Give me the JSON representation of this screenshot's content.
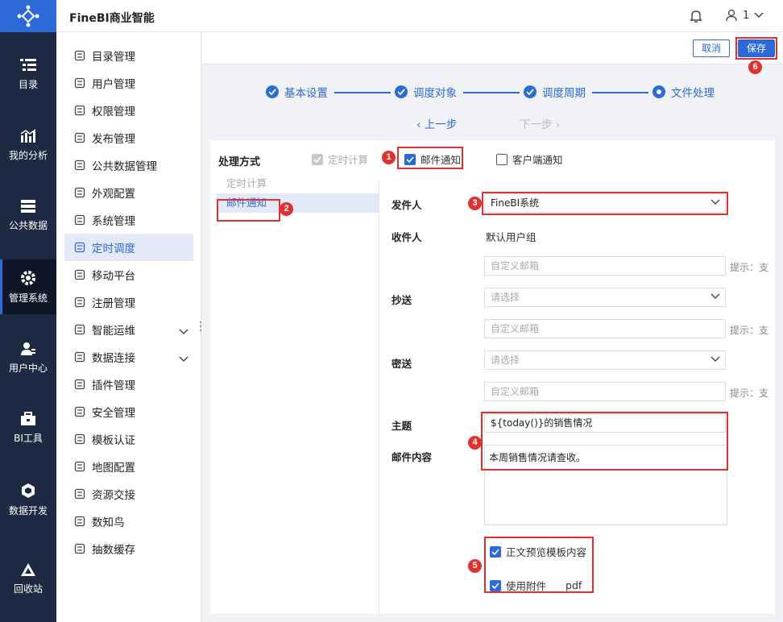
{
  "app": {
    "title": "FineBI商业智能",
    "user": "1"
  },
  "rail": [
    {
      "label": "目录",
      "icon": "catalog-icon"
    },
    {
      "label": "我的分析",
      "icon": "analysis-icon"
    },
    {
      "label": "公共数据",
      "icon": "public-data-icon"
    },
    {
      "label": "管理系统",
      "icon": "gear-icon",
      "active": true
    },
    {
      "label": "用户中心",
      "icon": "user-center-icon"
    },
    {
      "label": "BI工具",
      "icon": "toolbox-icon"
    },
    {
      "label": "数据开发",
      "icon": "data-dev-icon"
    },
    {
      "label": "回收站",
      "icon": "recycle-icon"
    }
  ],
  "subnav": [
    {
      "label": "目录管理",
      "icon": "directory-icon"
    },
    {
      "label": "用户管理",
      "icon": "user-icon"
    },
    {
      "label": "权限管理",
      "icon": "permission-icon"
    },
    {
      "label": "发布管理",
      "icon": "publish-icon"
    },
    {
      "label": "公共数据管理",
      "icon": "public-data-manage-icon"
    },
    {
      "label": "外观配置",
      "icon": "appearance-icon"
    },
    {
      "label": "系统管理",
      "icon": "system-icon"
    },
    {
      "label": "定时调度",
      "icon": "timer-icon",
      "active": true
    },
    {
      "label": "移动平台",
      "icon": "mobile-icon"
    },
    {
      "label": "注册管理",
      "icon": "register-icon"
    },
    {
      "label": "智能运维",
      "icon": "ops-icon",
      "expandable": true
    },
    {
      "label": "数据连接",
      "icon": "link-icon",
      "expandable": true
    },
    {
      "label": "插件管理",
      "icon": "plugin-icon"
    },
    {
      "label": "安全管理",
      "icon": "security-icon"
    },
    {
      "label": "模板认证",
      "icon": "template-icon"
    },
    {
      "label": "地图配置",
      "icon": "map-icon"
    },
    {
      "label": "资源交接",
      "icon": "resource-icon"
    },
    {
      "label": "数知鸟",
      "icon": "bird-icon"
    },
    {
      "label": "抽数缓存",
      "icon": "cache-icon"
    }
  ],
  "toolbar": {
    "cancel": "取消",
    "save": "保存"
  },
  "steps": [
    "基本设置",
    "调度对象",
    "调度周期",
    "文件处理"
  ],
  "nav": {
    "prev": "上一步",
    "next": "下一步"
  },
  "mode": {
    "label": "处理方式",
    "options": [
      {
        "label": "定时计算",
        "state": "disabled"
      },
      {
        "label": "邮件通知",
        "state": "checked"
      },
      {
        "label": "客户端通知",
        "state": "unchecked"
      }
    ]
  },
  "left_list": [
    {
      "label": "定时计算",
      "state": "disabled"
    },
    {
      "label": "邮件通知",
      "state": "selected"
    }
  ],
  "form": {
    "sender_label": "发件人",
    "sender_value": "FineBI系统",
    "recipient_label": "收件人",
    "recipient_value": "默认用户组",
    "custom_email_placeholder": "自定义邮箱",
    "hint": "提示：支",
    "cc_label": "抄送",
    "bcc_label": "密送",
    "select_placeholder": "请选择",
    "subject_label": "主题",
    "subject_value": "${today()}的销售情况",
    "content_label": "邮件内容",
    "content_value": "本周销售情况请查收。",
    "preview_label": "正文预览模板内容",
    "attach_label": "使用附件",
    "attach_format": "pdf"
  },
  "badges": [
    "1",
    "2",
    "3",
    "4",
    "5",
    "6"
  ],
  "colors": {
    "accent": "#2c6ad8",
    "rail": "#1e2a44",
    "highlight": "#e03131"
  }
}
